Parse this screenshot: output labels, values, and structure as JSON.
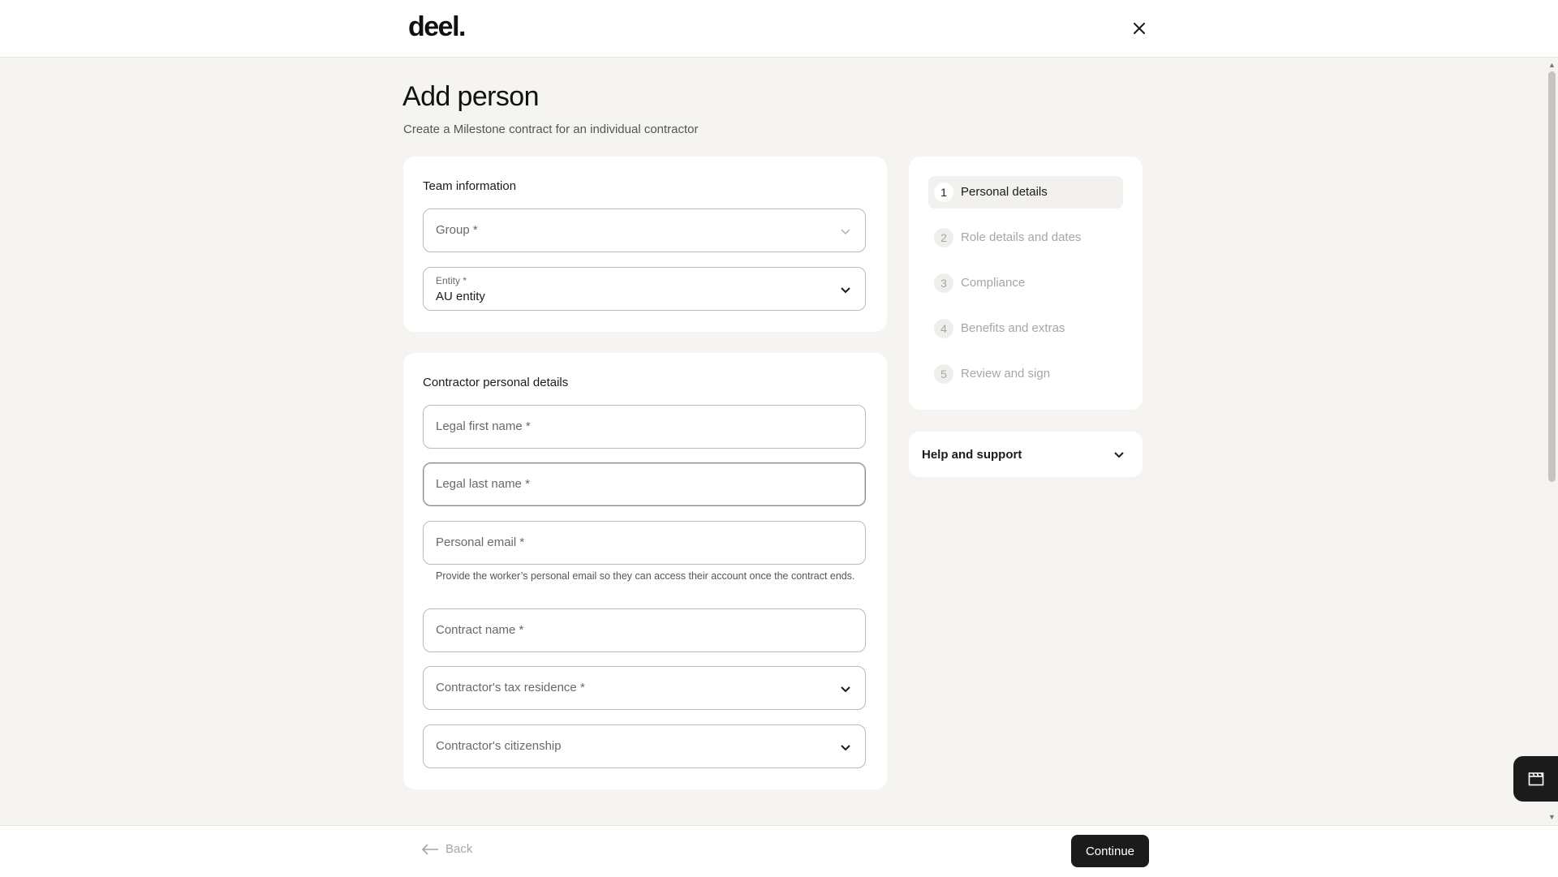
{
  "header": {
    "logo_text": "deel.",
    "close_icon": "close-icon"
  },
  "page": {
    "title": "Add person",
    "subtitle": "Create a Milestone contract for an individual contractor"
  },
  "team_information": {
    "title": "Team information",
    "group_placeholder": "Group *",
    "entity_label": "Entity *",
    "entity_value": "AU entity"
  },
  "contractor_details": {
    "title": "Contractor personal details",
    "first_name_placeholder": "Legal first name *",
    "last_name_placeholder": "Legal last name *",
    "email_placeholder": "Personal email *",
    "email_helper": "Provide the worker’s personal email so they can access their account once the contract ends.",
    "contract_name_placeholder": "Contract name *",
    "tax_residence_placeholder": "Contractor's tax residence *",
    "citizenship_placeholder": "Contractor's citizenship"
  },
  "steps": [
    {
      "number": "1",
      "label": "Personal details",
      "active": true
    },
    {
      "number": "2",
      "label": "Role details and dates",
      "active": false
    },
    {
      "number": "3",
      "label": "Compliance",
      "active": false
    },
    {
      "number": "4",
      "label": "Benefits and extras",
      "active": false
    },
    {
      "number": "5",
      "label": "Review and sign",
      "active": false
    }
  ],
  "help": {
    "title": "Help and support"
  },
  "footer": {
    "back_label": "Back",
    "continue_label": "Continue"
  },
  "colors": {
    "background": "#f5f4f1",
    "card": "#ffffff",
    "primary_button": "#1b1b1b",
    "muted_text": "#a8a6a0"
  }
}
